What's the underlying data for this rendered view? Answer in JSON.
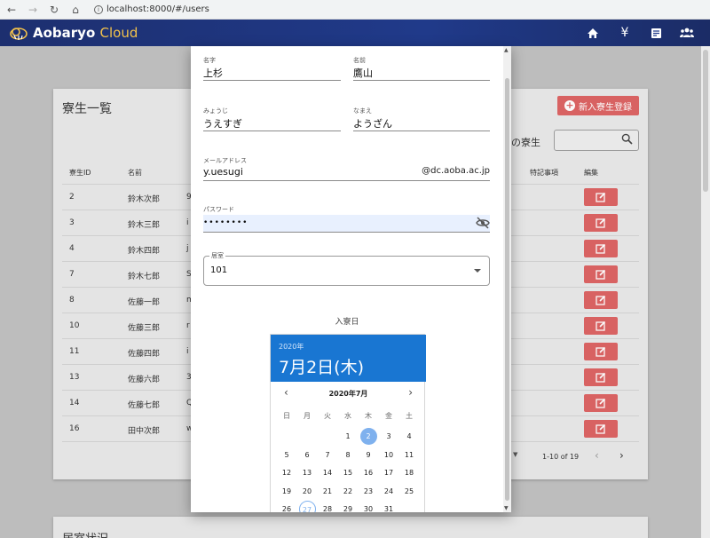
{
  "browser": {
    "url": "localhost:8000/#/users"
  },
  "app": {
    "brand_main": "Aobaryo",
    "brand_sub": "Cloud",
    "nav_icons": [
      "home-icon",
      "yen-icon",
      "receipt-icon",
      "people-icon"
    ]
  },
  "card": {
    "title": "寮生一覧",
    "add_button": "新入寮生登録",
    "past_label": "去の寮生",
    "columns": [
      "寮生ID",
      "名前",
      "特記事項",
      "編集"
    ],
    "rows": [
      {
        "id": "2",
        "name": "鈴木次郎",
        "c": "9"
      },
      {
        "id": "3",
        "name": "鈴木三郎",
        "c": "i"
      },
      {
        "id": "4",
        "name": "鈴木四郎",
        "c": "j"
      },
      {
        "id": "7",
        "name": "鈴木七郎",
        "c": "S"
      },
      {
        "id": "8",
        "name": "佐藤一郎",
        "c": "m"
      },
      {
        "id": "10",
        "name": "佐藤三郎",
        "c": "r"
      },
      {
        "id": "11",
        "name": "佐藤四郎",
        "c": "i"
      },
      {
        "id": "13",
        "name": "佐藤六郎",
        "c": "3"
      },
      {
        "id": "14",
        "name": "佐藤七郎",
        "c": "Q"
      },
      {
        "id": "16",
        "name": "田中次郎",
        "c": "w"
      }
    ],
    "pager_text": "1-10 of 19"
  },
  "card2": {
    "title": "居室状況"
  },
  "dialog": {
    "last_name_label": "名字",
    "last_name": "上杉",
    "first_name_label": "名前",
    "first_name": "鷹山",
    "last_kana_label": "みょうじ",
    "last_kana": "うえすぎ",
    "first_kana_label": "なまえ",
    "first_kana": "ようざん",
    "email_label": "メールアドレス",
    "email": "y.uesugi",
    "email_domain": "@dc.aoba.ac.jp",
    "password_label": "パスワード",
    "password": "••••••••",
    "room_label": "居室",
    "room": "101",
    "date_label": "入寮日",
    "picker": {
      "year": "2020年",
      "date": "7月2日(木)",
      "month": "2020年7月",
      "weekdays": [
        "日",
        "月",
        "火",
        "水",
        "木",
        "金",
        "土"
      ],
      "days": [
        "1",
        "2",
        "3",
        "4",
        "5",
        "6",
        "7",
        "8",
        "9",
        "10",
        "11",
        "12",
        "13",
        "14",
        "15",
        "16",
        "17",
        "18",
        "19",
        "20",
        "21",
        "22",
        "23",
        "24",
        "25",
        "26",
        "27",
        "28",
        "29",
        "30",
        "31"
      ],
      "selected_day": "2",
      "today_day": "27"
    }
  }
}
